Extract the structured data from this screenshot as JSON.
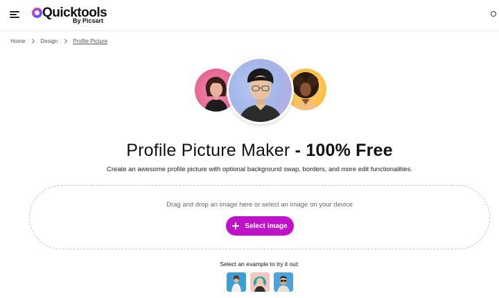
{
  "header": {
    "logo_text": "Quicktools",
    "logo_sub": "By Picsart",
    "menu_icon": "menu-icon",
    "user_icon": "user-icon"
  },
  "breadcrumb": {
    "items": [
      "Home",
      "Design",
      "Profile Picture"
    ]
  },
  "hero": {
    "title_normal": "Profile Picture Maker ",
    "title_bold": "- 100% Free",
    "subtitle": "Create an awesome profile picture with optional background swap, borders, and more edit functionalities."
  },
  "upload": {
    "drop_text": "Drag and drop an image here or select an image on your device",
    "button_label": "Select image",
    "button_icon": "plus-icon"
  },
  "examples": {
    "label": "Select an example to try it out:"
  },
  "colors": {
    "accent": "#c012c8",
    "avatar_left_bg": "#e86c98",
    "avatar_center_bg": "#a4b6ea",
    "avatar_right_bg": "#ffc24a"
  }
}
